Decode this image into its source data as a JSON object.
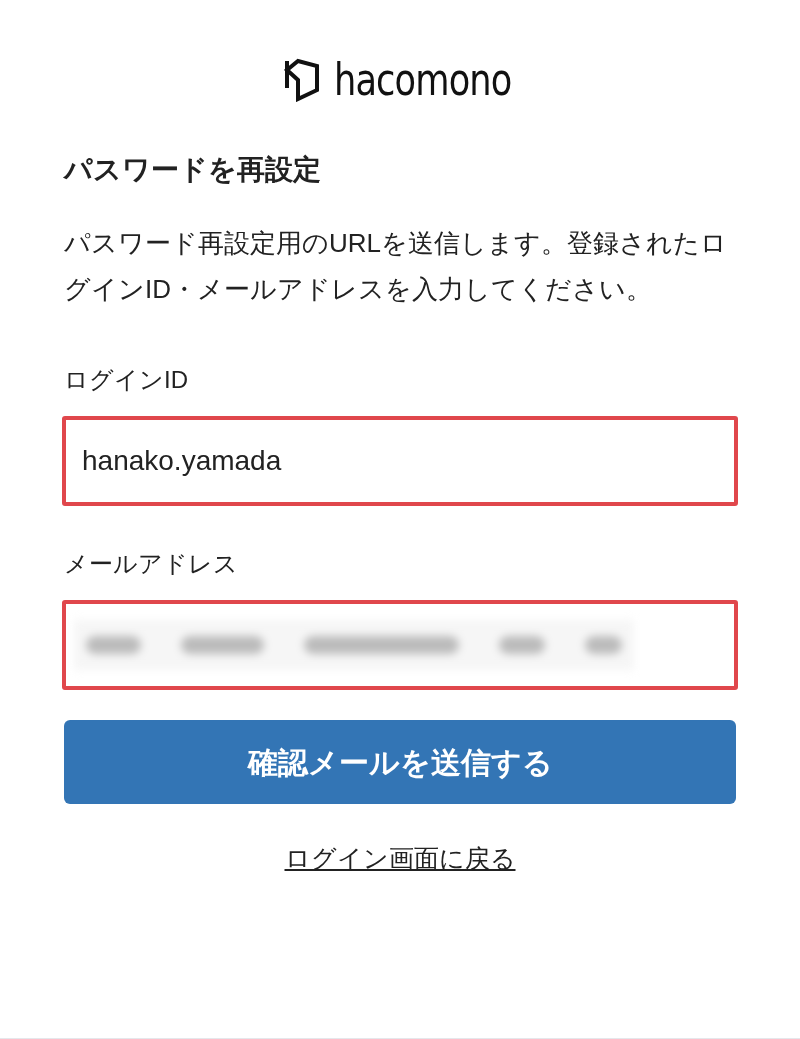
{
  "logo": {
    "text": "hacomono"
  },
  "heading": "パスワードを再設定",
  "description": "パスワード再設定用のURLを送信します。登録されたログインID・メールアドレスを入力してください。",
  "fields": [
    {
      "label": "ログインID",
      "value": "hanako.yamada",
      "redacted": false,
      "highlighted": true
    },
    {
      "label": "メールアドレス",
      "redacted": true,
      "highlighted": true
    }
  ],
  "submit_button": "確認メールを送信する",
  "back_link": "ログイン画面に戻る"
}
